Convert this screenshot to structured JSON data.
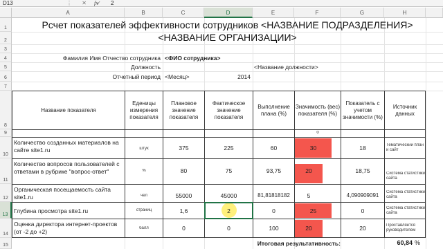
{
  "formula_bar": {
    "name_box": "D13",
    "value": "2",
    "fx": "fx",
    "icons": "⋮ ✕ ✓"
  },
  "columns": [
    "A",
    "B",
    "C",
    "D",
    "E",
    "F",
    "G",
    "H"
  ],
  "selected_column": "D",
  "rows": [
    "1",
    "2",
    "3",
    "4",
    "5",
    "6",
    "7",
    "8",
    "9",
    "10",
    "11",
    "12",
    "13",
    "14",
    "15"
  ],
  "selected_row": "13",
  "title_line1": "Рсчет показателей эффективности сотрудников <НАЗВАНИЕ ПОДРАЗДЕЛЕНИЯ>",
  "title_line2": "<НАЗВАНИЕ ОРГАНИЗАЦИИ>",
  "employee": {
    "name_label": "Фамилия Имя Отчество сотрудника",
    "name_value": "<ФИО сотрудника>",
    "position_label": "Должность",
    "position_value": "<Название должности>",
    "period_label": "Отчетный период",
    "period_month": "<Месяц>",
    "period_year": "2014"
  },
  "table_headers": {
    "name": "Название показателя",
    "unit": "Еденицы измерения показателя",
    "plan": "Плановое значение показателя",
    "fact": "Фактическое значение показателя",
    "completion": "Выполнение плана (%)",
    "weight": "Значимость (вес) показателя (%)",
    "weighted": "Показатель с учетом значимости (%)",
    "source": "Источник данных"
  },
  "row9_weight": "0",
  "table_rows": [
    {
      "name": "Количество созданных материалов на сайте site1.ru",
      "unit": "штук",
      "plan": "375",
      "fact": "225",
      "completion": "60",
      "weight": "30",
      "weighted": "18",
      "source": "Тематический план и сайт"
    },
    {
      "name": "Количество вопросов пользователей с ответами в рубрике \"вопрос-ответ\"",
      "unit": "%",
      "plan": "80",
      "fact": "75",
      "completion": "93,75",
      "weight": "20",
      "weighted": "18,75",
      "source": "Система статистики сайта"
    },
    {
      "name": "Органическая посещаемость сайта site1.ru",
      "unit": "чел",
      "plan": "55000",
      "fact": "45000",
      "completion": "81,81818182",
      "weight": "5",
      "weighted": "4,090909091",
      "source": "Система статистики сайта"
    },
    {
      "name": "Глубина просмотра site1.ru",
      "unit": "страниц",
      "plan": "1,6",
      "fact": "2",
      "completion": "0",
      "weight": "25",
      "weighted": "0",
      "source": "Система статистики сайта"
    },
    {
      "name": "Оценка директора интернет-проектов (от -2 до +2)",
      "unit": "балл",
      "plan": "0",
      "fact": "0",
      "completion": "100",
      "weight": "20",
      "weighted": "20",
      "source": "Проставляется руководителем"
    }
  ],
  "total_label": "Итоговая результативность:",
  "total_value": "60,84",
  "total_unit": "%",
  "colors": {
    "accent": "#217346",
    "highlight": "#f4564d"
  }
}
